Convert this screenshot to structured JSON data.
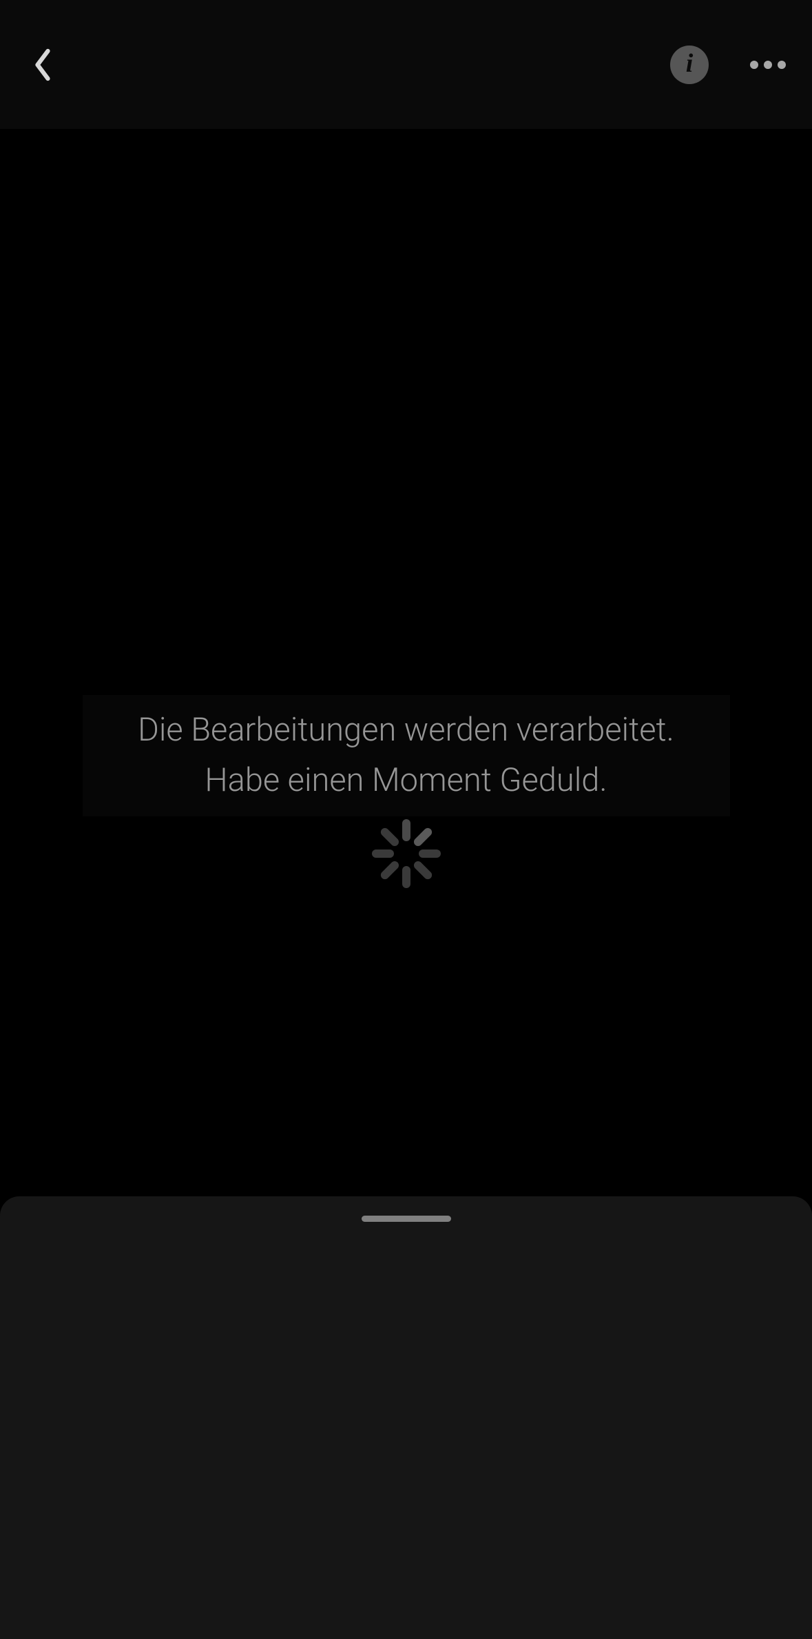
{
  "processing": {
    "line1": "Die Bearbeitungen werden verarbeitet.",
    "line2": "Habe einen Moment Geduld."
  }
}
